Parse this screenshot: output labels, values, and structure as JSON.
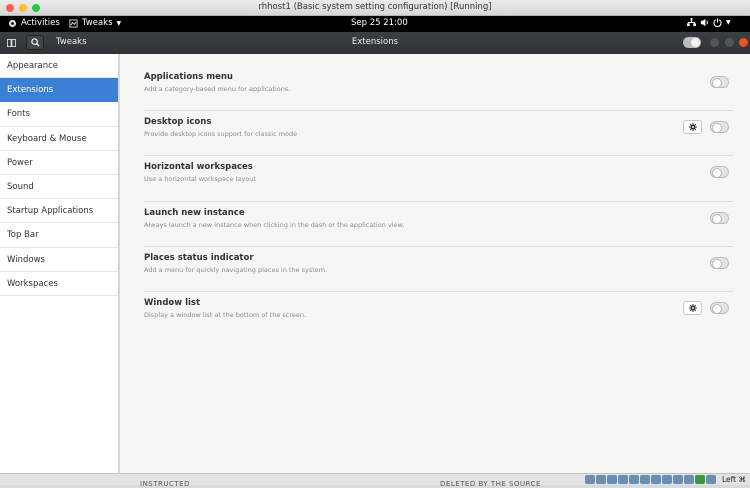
{
  "window": {
    "title": "rhhost1 (Basic system setting configuration) [Running]",
    "traffic_lights": [
      "#fe5f57",
      "#febc2e",
      "#28c840"
    ]
  },
  "gnome_bar": {
    "activities": "Activities",
    "app_menu": "Tweaks",
    "clock": "Sep 25  21:00"
  },
  "header": {
    "app_name": "Tweaks",
    "view_title": "Extensions",
    "global_switch": "off"
  },
  "sidebar": {
    "items": [
      {
        "label": "Appearance"
      },
      {
        "label": "Extensions",
        "selected": true
      },
      {
        "label": "Fonts"
      },
      {
        "label": "Keyboard & Mouse"
      },
      {
        "label": "Power"
      },
      {
        "label": "Sound"
      },
      {
        "label": "Startup Applications"
      },
      {
        "label": "Top Bar"
      },
      {
        "label": "Windows"
      },
      {
        "label": "Workspaces"
      }
    ]
  },
  "extensions": [
    {
      "name": "Applications menu",
      "description": "Add a category-based menu for applications.",
      "has_settings": false,
      "enabled": false
    },
    {
      "name": "Desktop icons",
      "description": "Provide desktop icons support for classic mode",
      "has_settings": true,
      "enabled": false
    },
    {
      "name": "Horizontal workspaces",
      "description": "Use a horizontal workspace layout",
      "has_settings": false,
      "enabled": false
    },
    {
      "name": "Launch new instance",
      "description": "Always launch a new instance when clicking in the dash or the application view.",
      "has_settings": false,
      "enabled": false
    },
    {
      "name": "Places status indicator",
      "description": "Add a menu for quickly navigating places in the system.",
      "has_settings": false,
      "enabled": false
    },
    {
      "name": "Window list",
      "description": "Display a window list at the bottom of the screen.",
      "has_settings": true,
      "enabled": false
    }
  ],
  "statusbar": {
    "host_key": "Left ⌘",
    "ghost_left": "INSTRUCTED",
    "ghost_right": "DELETED BY THE SOURCE"
  },
  "colors": {
    "accent": "#3b80d6",
    "header_bg": "#2f3338",
    "content_bg": "#f6f6f5"
  }
}
